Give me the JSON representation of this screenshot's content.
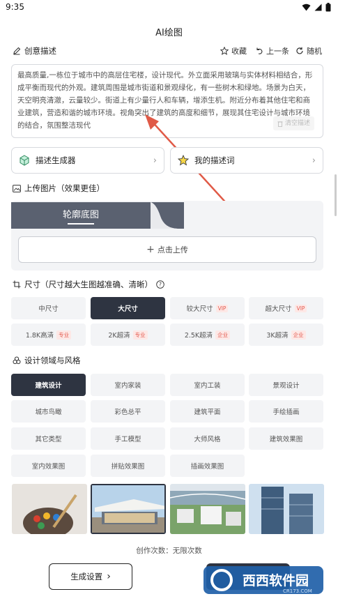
{
  "status": {
    "time": "9:35"
  },
  "app": {
    "title": "AI绘图"
  },
  "creative": {
    "label": "创意描述",
    "favorite": "收藏",
    "previous": "上一条",
    "random": "随机",
    "text": "最高质量,一栋位于城市中的高层住宅楼，设计现代。外立面采用玻璃与实体材料相结合，形成平衡而现代的外观。建筑周围是城市街道和景观绿化，有一些树木和绿地。场景为白天，天空明亮清澈，云量较少。街道上有少量行人和车辆，增添生机。附近分布着其他住宅和商业建筑，营造和谐的城市环境。视角突出了建筑的高度和细节，展现其住宅设计与城市环境的结合，氛围整洁现代",
    "clear": "清空描述"
  },
  "cards": {
    "generator": "描述生成器",
    "my_prompts": "我的描述词"
  },
  "upload": {
    "label": "上传图片（效果更佳）",
    "tab": "轮廓底图",
    "button": "点击上传"
  },
  "size": {
    "label": "尺寸（尺寸越大生图越准确、清晰）",
    "options": [
      {
        "label": "中尺寸",
        "tag": "",
        "selected": false
      },
      {
        "label": "大尺寸",
        "tag": "",
        "selected": true
      },
      {
        "label": "较大尺寸",
        "tag": "VIP",
        "selected": false
      },
      {
        "label": "超大尺寸",
        "tag": "VIP",
        "selected": false
      },
      {
        "label": "1.8K高清",
        "tag": "专业",
        "selected": false
      },
      {
        "label": "2K超清",
        "tag": "专业",
        "selected": false
      },
      {
        "label": "2.5K超清",
        "tag": "企业",
        "selected": false
      },
      {
        "label": "3K超清",
        "tag": "企业",
        "selected": false
      }
    ]
  },
  "style": {
    "label": "设计领域与风格",
    "options": [
      {
        "label": "建筑设计",
        "selected": true
      },
      {
        "label": "室内家装",
        "selected": false
      },
      {
        "label": "室内工装",
        "selected": false
      },
      {
        "label": "景观设计",
        "selected": false
      },
      {
        "label": "城市鸟瞰",
        "selected": false
      },
      {
        "label": "彩色总平",
        "selected": false
      },
      {
        "label": "建筑平面",
        "selected": false
      },
      {
        "label": "手绘插画",
        "selected": false
      },
      {
        "label": "其它类型",
        "selected": false
      },
      {
        "label": "手工模型",
        "selected": false
      },
      {
        "label": "大师风格",
        "selected": false
      },
      {
        "label": "建筑效果图",
        "selected": false
      },
      {
        "label": "室内效果图",
        "selected": false
      },
      {
        "label": "拼贴效果图",
        "selected": false
      },
      {
        "label": "插画效果图",
        "selected": false
      }
    ]
  },
  "footer": {
    "count_label": "创作次数：无限次数",
    "generate_settings": "生成设置",
    "watermark_text": "西西软件园",
    "watermark_url": "CR173.COM"
  },
  "colors": {
    "accent_dark": "#2e3441",
    "tag_red": "#e45a4f",
    "arrow_red": "#e05a47"
  }
}
